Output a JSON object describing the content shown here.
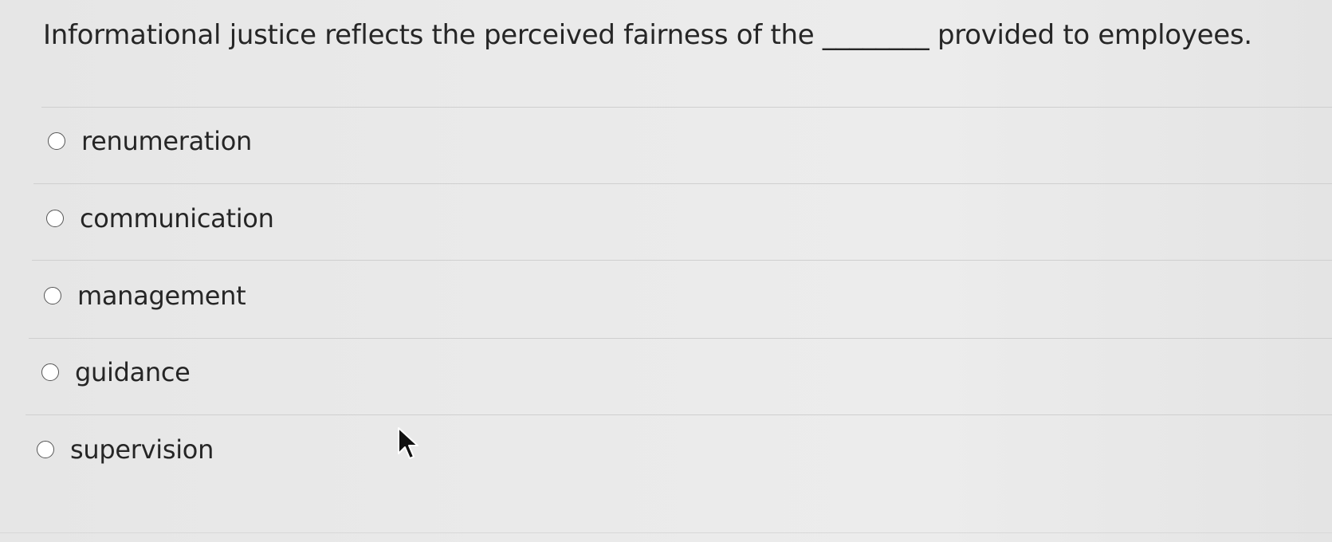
{
  "question": {
    "text": "Informational justice reflects the perceived fairness of the ________ provided to employees."
  },
  "options": [
    {
      "label": "renumeration",
      "selected": false
    },
    {
      "label": "communication",
      "selected": false
    },
    {
      "label": "management",
      "selected": false
    },
    {
      "label": "guidance",
      "selected": false
    },
    {
      "label": "supervision",
      "selected": false
    }
  ],
  "icons": {
    "radio": "radio-circle-icon",
    "cursor": "mouse-pointer-icon"
  },
  "colors": {
    "background": "#e9e9e9",
    "text": "#262626",
    "divider": "#cfcfcf"
  }
}
